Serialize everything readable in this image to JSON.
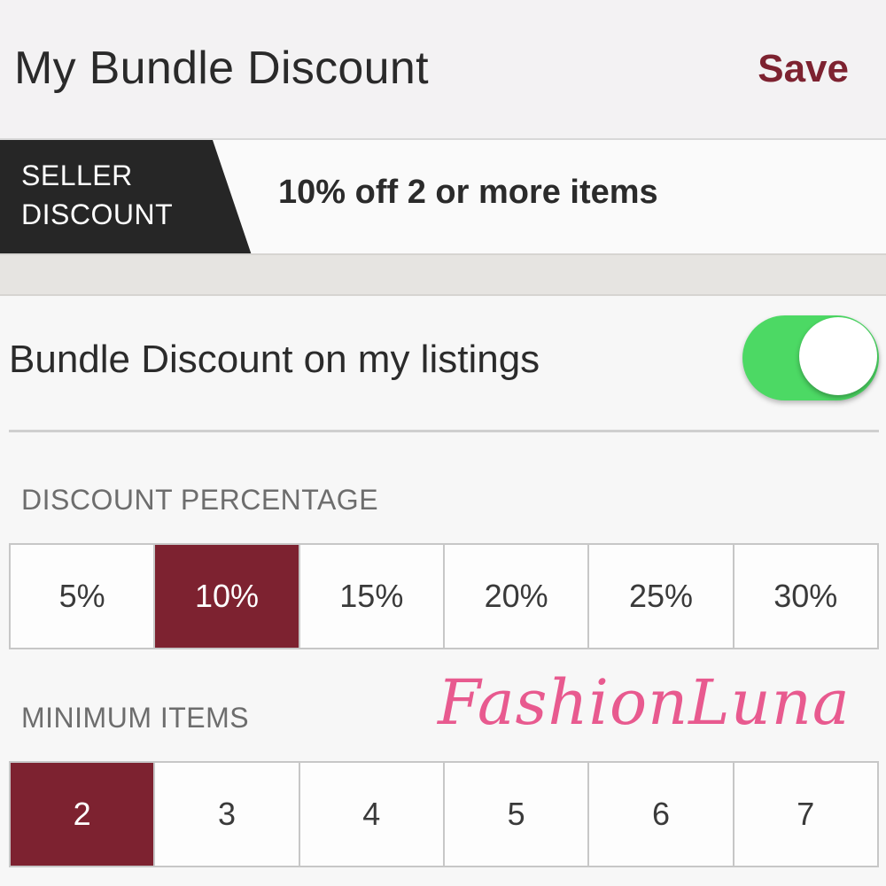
{
  "colors": {
    "accent": "#7d2230",
    "save_text": "#7d2230",
    "toggle_on": "#4cd964",
    "watermark": "#e85a8f"
  },
  "header": {
    "title": "My Bundle Discount",
    "save_label": "Save"
  },
  "seller_discount": {
    "tag_label": "SELLER\nDISCOUNT",
    "summary": "10% off 2 or more items"
  },
  "bundle_toggle": {
    "label": "Bundle Discount on my listings",
    "enabled": true
  },
  "discount_percentage": {
    "heading": "DISCOUNT PERCENTAGE",
    "options": [
      "5%",
      "10%",
      "15%",
      "20%",
      "25%",
      "30%"
    ],
    "selected_value": "10%"
  },
  "minimum_items": {
    "heading": "MINIMUM ITEMS",
    "options": [
      "2",
      "3",
      "4",
      "5",
      "6",
      "7"
    ],
    "selected_value": "2"
  },
  "watermark": {
    "text": "FashionLuna"
  }
}
